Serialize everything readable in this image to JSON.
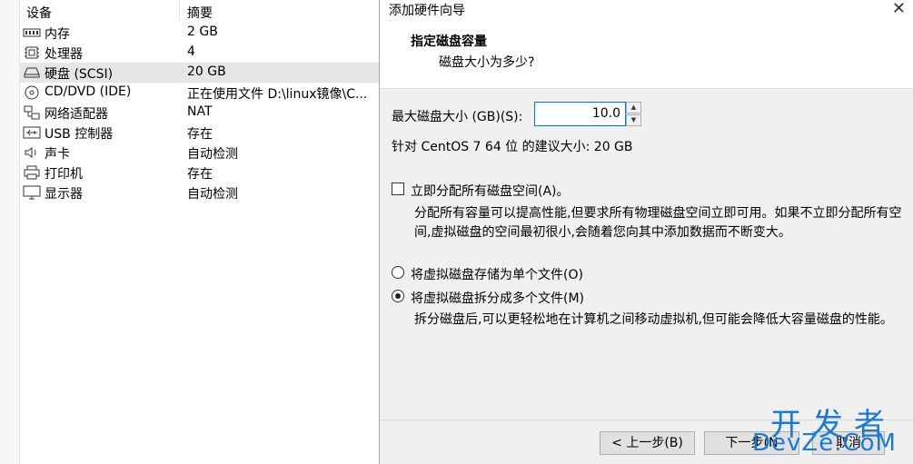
{
  "devices": {
    "header": {
      "device": "设备",
      "summary": "摘要"
    },
    "rows": [
      {
        "name": "内存",
        "value": "2 GB",
        "icon": "memory-icon"
      },
      {
        "name": "处理器",
        "value": "4",
        "icon": "cpu-icon"
      },
      {
        "name": "硬盘 (SCSI)",
        "value": "20 GB",
        "icon": "harddisk-icon",
        "selected": true
      },
      {
        "name": "CD/DVD (IDE)",
        "value": "正在使用文件 D:\\linux镜像\\C...",
        "icon": "cdrom-icon"
      },
      {
        "name": "网络适配器",
        "value": "NAT",
        "icon": "network-icon"
      },
      {
        "name": "USB 控制器",
        "value": "存在",
        "icon": "usb-icon"
      },
      {
        "name": "声卡",
        "value": "自动检测",
        "icon": "speaker-icon"
      },
      {
        "name": "打印机",
        "value": "存在",
        "icon": "printer-icon"
      },
      {
        "name": "显示器",
        "value": "自动检测",
        "icon": "monitor-icon"
      }
    ]
  },
  "wizard": {
    "title": "添加硬件向导",
    "heading": "指定磁盘容量",
    "subheading": "磁盘大小为多少?",
    "max_size_label": "最大磁盘大小 (GB)(S):",
    "max_size_value": "10.0",
    "recommend": "针对 CentOS 7 64 位 的建议大小: 20 GB",
    "allocate_label": "立即分配所有磁盘空间(A)。",
    "allocate_desc": "分配所有容量可以提高性能,但要求所有物理磁盘空间立即可用。如果不立即分配所有空间,虚拟磁盘的空间最初很小,会随着您向其中添加数据而不断变大。",
    "single_file_label": "将虚拟磁盘存储为单个文件(O)",
    "multi_file_label": "将虚拟磁盘拆分成多个文件(M)",
    "multi_file_desc": "拆分磁盘后,可以更轻松地在计算机之间移动虚拟机,但可能会降低大容量磁盘的性能。",
    "prev_button": "< 上一步(B)",
    "next_button": "下一步(N",
    "cancel_button": "取消"
  },
  "watermark": {
    "top": "开发者",
    "bottom": "DevZe.CoM"
  }
}
